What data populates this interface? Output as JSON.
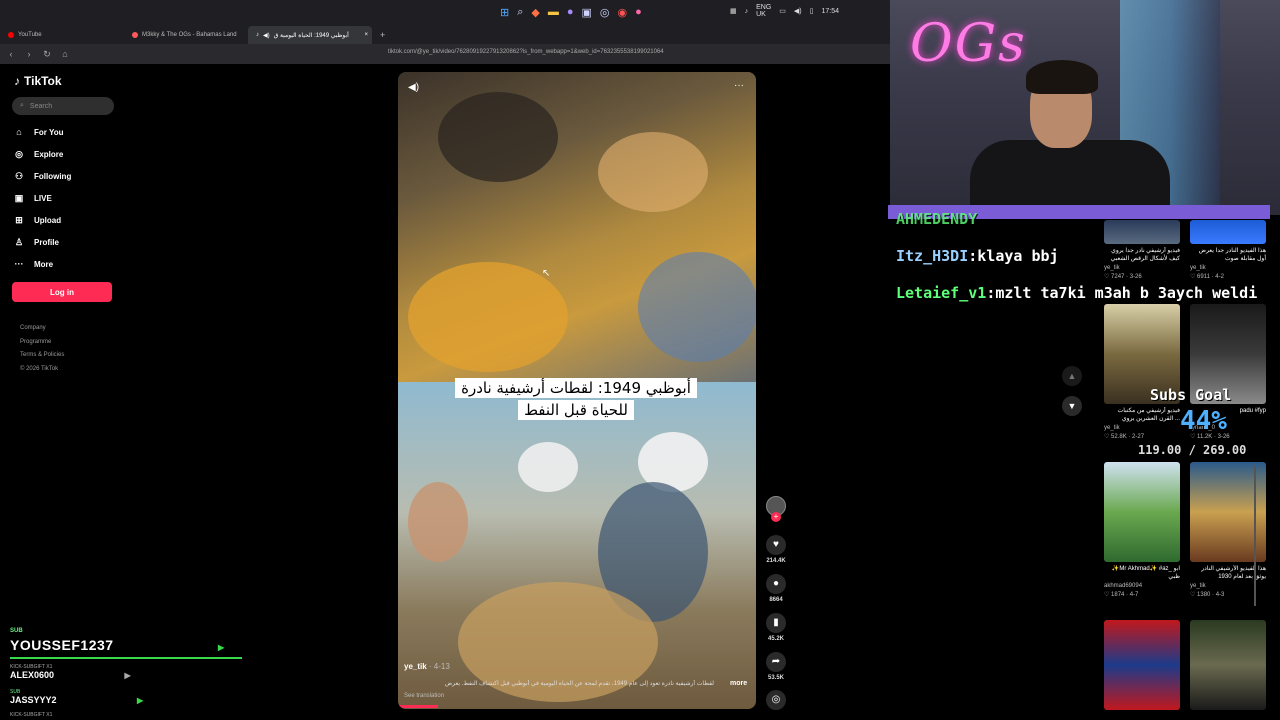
{
  "browser": {
    "tabs": [
      {
        "label": "YouTube",
        "color": "#ff0000"
      },
      {
        "label": "M3kky & The OGs - Bahamas Land",
        "color": "#ff5a5a"
      },
      {
        "label": "أبوظبي 1949: الحياة اليومية ق",
        "color": "#ffffff"
      }
    ],
    "new_tab": "+",
    "url": "tiktok.com/@ye_tik/video/7628091922791320862?is_from_webapp=1&web_id=7632355538199021064",
    "tray_lang": "ENG",
    "tray_region": "UK",
    "clock": "17:54"
  },
  "tiktok": {
    "logo": "TikTok",
    "search_placeholder": "Search",
    "nav": [
      {
        "label": "For You",
        "icon": "home-icon"
      },
      {
        "label": "Explore",
        "icon": "compass-icon"
      },
      {
        "label": "Following",
        "icon": "following-icon"
      },
      {
        "label": "LIVE",
        "icon": "live-icon"
      },
      {
        "label": "Upload",
        "icon": "upload-icon"
      },
      {
        "label": "Profile",
        "icon": "person-icon"
      },
      {
        "label": "More",
        "icon": "more-icon"
      }
    ],
    "login": "Log in",
    "footer": [
      "Company",
      "Programme",
      "Terms & Policies",
      "© 2026 TikTok"
    ]
  },
  "video": {
    "caption_line1": "أبوظبي 1949: لقطات أرشيفية نادرة",
    "caption_line2": "للحياة قبل النفط",
    "username": "ye_tik",
    "time": "· 4-13",
    "description": "لقطات أرشيفية نادرة تعود إلى عام 1949، تقدم لمحة عن الحياة اليومية في أبوظبي قبل اكتشاف النفط. يعرض",
    "more": "more",
    "see_translation": "See translation",
    "likes": "214.4K",
    "comments": "8664",
    "saves": "45.2K",
    "shares": "53.5K"
  },
  "stream": {
    "sub_label": "SUB",
    "sub_user": "YOUSSEF1237",
    "kick_label": "KICK-SUBGIFT X1",
    "kick_user": "ALEX0600",
    "sub2_label": "SUB",
    "sub2_user": "JASSYYY2",
    "sub3_label": "KICK-SUBGIFT X1",
    "subs_goal": "Subs Goal",
    "subs_pct": "44%",
    "subs_count": "119.00 / 269.00",
    "webcam_sign": "OGs"
  },
  "chat": [
    {
      "user": "AHMEDENDY",
      "message": ""
    },
    {
      "user": "Itz_H3DI",
      "message": ":klaya bbj"
    },
    {
      "user": "Letaief_v1",
      "message": ":mzlt ta7ki m3ah b 3aych weldi"
    }
  ],
  "recommendations": [
    {
      "title": "فيديو أرشيفي نادر جدا يروي كيف لأشكال الرقص الشعبي",
      "author": "ye_tik",
      "stats": "♡ 7247 · 3-26"
    },
    {
      "title": "هذا الفيديو النادر جدا يعرض أول مقابلة صوت",
      "author": "ye_tik",
      "stats": "♡ 6911 · 4-2"
    },
    {
      "title": "فيديو أرشيفي من مكتبات القرن العشرين يروي ...",
      "author": "ye_tik",
      "stats": "♡ 52.8K · 2-27"
    },
    {
      "title": "padu #fyp",
      "author": "rynand_0",
      "stats": "♡ 11.2K · 3-26"
    },
    {
      "title": "✨Mr Akhmad✨ #az_ ابو ظبي",
      "author": "akhmad69094",
      "stats": "♡ 1874 · 4-7"
    },
    {
      "title": "هذا الفيديو الأرشيفي النادر يوثق بعد لعام 1930",
      "author": "ye_tik",
      "stats": "♡ 1380 · 4-3"
    },
    {
      "title": "",
      "author": "",
      "stats": ""
    },
    {
      "title": "",
      "author": "",
      "stats": ""
    }
  ]
}
